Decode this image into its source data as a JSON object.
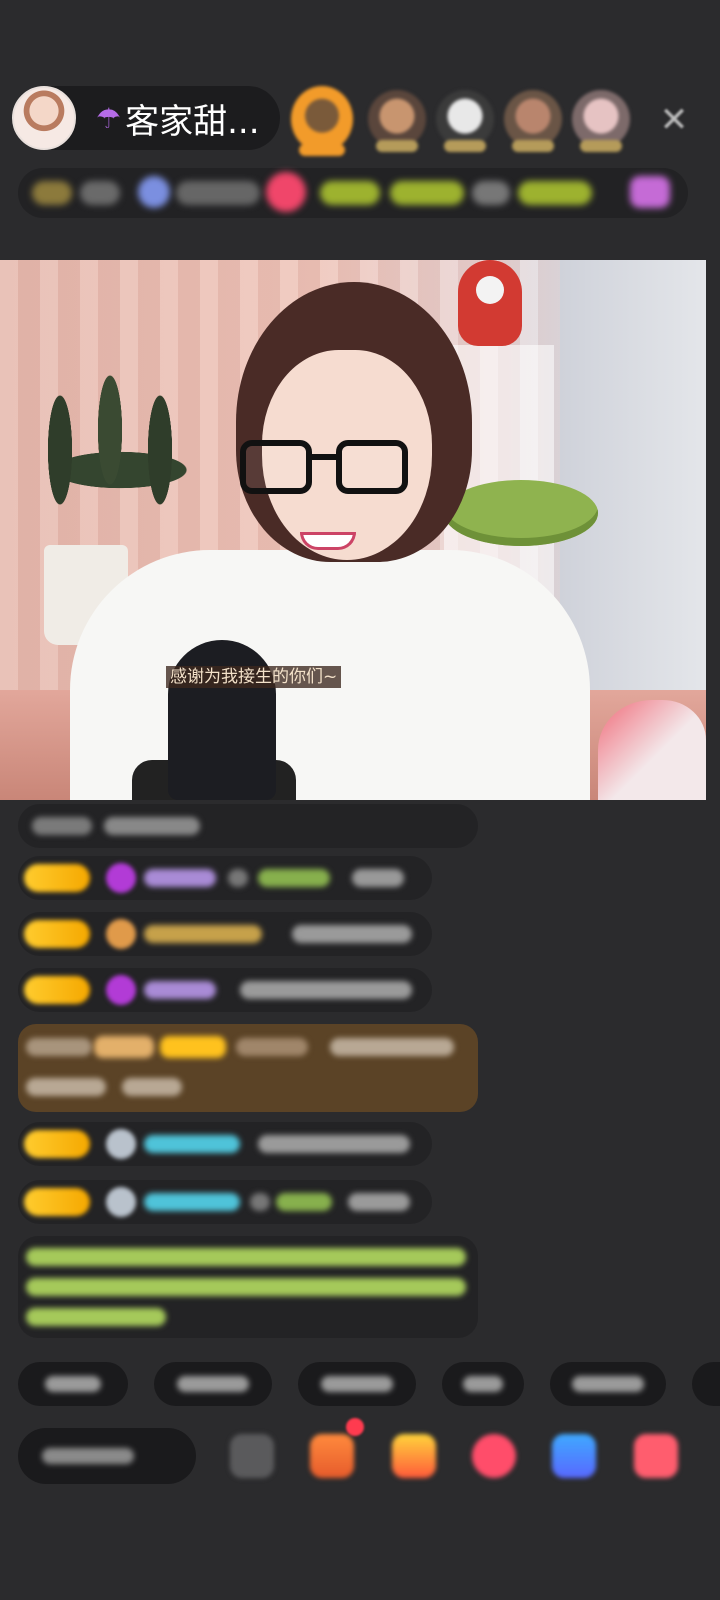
{
  "header": {
    "host_name": "客家甜...",
    "close_symbol": "✕",
    "umbrella_symbol": "☂",
    "viewer_avatars": [
      "viewer-1",
      "viewer-2",
      "viewer-3",
      "viewer-4",
      "viewer-5"
    ]
  },
  "video": {
    "subtitle": "感谢为我接生的你们~"
  },
  "colors": {
    "background": "#2b2b2d",
    "level_badge": "#ffcc2e",
    "highlight_row": "#5b4326",
    "system_text": "#a5c95a",
    "username_cyan": "#4fc3d9",
    "username_purple": "#a98bd6"
  },
  "icons": {
    "umbrella": "umbrella-icon",
    "close": "close-icon",
    "gift": "gift-icon",
    "emoji": "emoji-icon",
    "more": "more-icon"
  }
}
